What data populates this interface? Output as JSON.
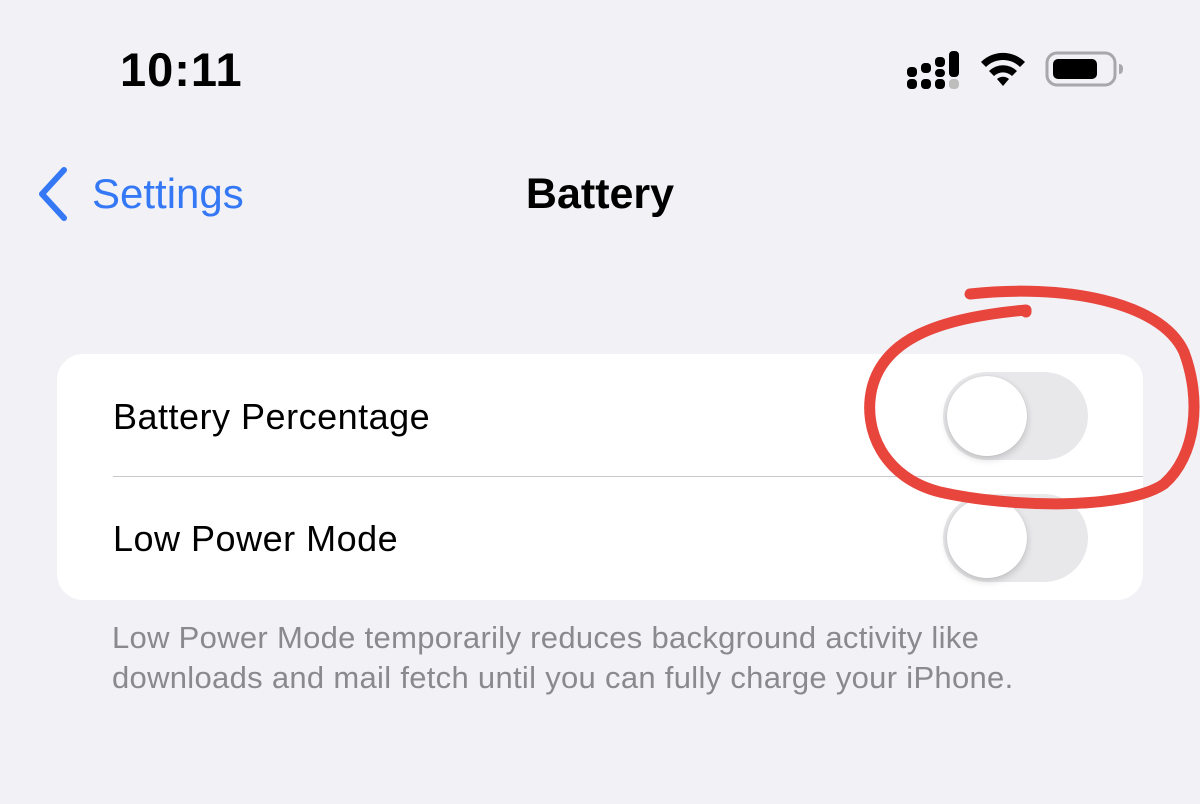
{
  "status_bar": {
    "time": "10:11",
    "icons": [
      "cellular-signal-icon",
      "wifi-icon",
      "battery-icon"
    ]
  },
  "nav": {
    "back_label": "Settings",
    "title": "Battery"
  },
  "settings": {
    "rows": [
      {
        "label": "Battery Percentage",
        "toggle_on": false
      },
      {
        "label": "Low Power Mode",
        "toggle_on": false
      }
    ],
    "footnote": "Low Power Mode temporarily reduces background activity like downloads and mail fetch until you can fully charge your iPhone."
  },
  "colors": {
    "accent": "#3478f6",
    "background": "#f1f1f6",
    "toggle_off": "#e8e8ea",
    "annotation": "#e8453c"
  }
}
